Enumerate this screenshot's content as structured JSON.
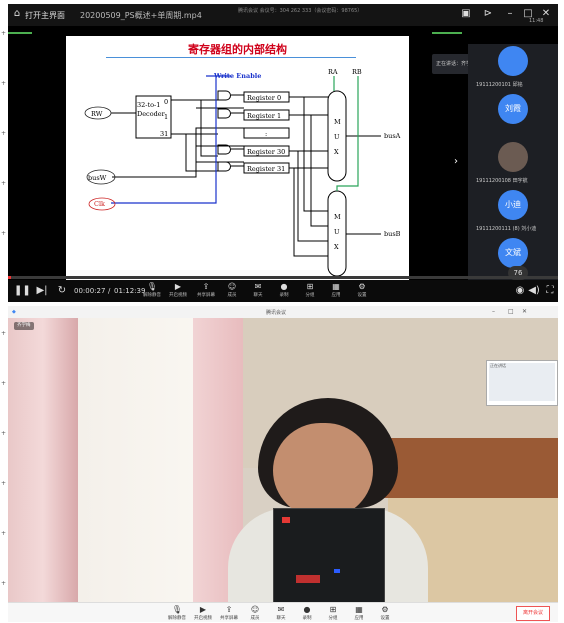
{
  "player": {
    "home_label": "打开主界面",
    "file_name": "20200509_PS概述+单周期.mp4",
    "meeting_info": "腾讯会议 会议号：304 262 333（会议密码：98765）",
    "clock": "11:48",
    "time_current": "00:00:27",
    "time_total": "01:12:39",
    "zoom": "76",
    "progress": 0.006
  },
  "slide": {
    "title": "寄存器组的内部结构",
    "write_enable": "Write Enable",
    "ra": "RA",
    "rb": "RB",
    "rw": "RW",
    "busw": "busW",
    "clk": "Clk",
    "decoder": "32-to-1 Decoder",
    "dec_top": "0",
    "dec_mid": "1",
    "dec_bot": "31",
    "registers": [
      "Register 0",
      "Register 1",
      ":",
      "Register 30",
      "Register 31"
    ],
    "mux": "M U X",
    "busa": "busA",
    "busb": "busB"
  },
  "participants": {
    "sharing": "正在讲话：齐学梅",
    "tiles": [
      {
        "name": "19111200101 邱铭",
        "avatar": ""
      },
      {
        "name": "",
        "avatar": "刘霞"
      },
      {
        "name": "19111200108 田宇航",
        "avatar": ""
      },
      {
        "name": "19111200111 (8) 刘小迪",
        "avatar": "小迪"
      },
      {
        "name": "",
        "avatar": "文斌"
      }
    ]
  },
  "player_toolbar": [
    "解除静音",
    "开启视频",
    "共享屏幕",
    "成员",
    "聊天",
    "录制",
    "分组",
    "应用",
    "设置"
  ],
  "meeting": {
    "title": "腾讯会议",
    "presenter": "齐学梅",
    "mini_label": "正在讲话",
    "toolbar": [
      "解除静音",
      "开启视频",
      "共享屏幕",
      "成员",
      "聊天",
      "录制",
      "分组",
      "应用",
      "设置"
    ],
    "leave": "离开会议"
  },
  "colors": {
    "accent_blue": "#3f86f2",
    "slide_title": "#d0021b",
    "green_border": "#4caf50",
    "progress_red": "#e33333"
  }
}
